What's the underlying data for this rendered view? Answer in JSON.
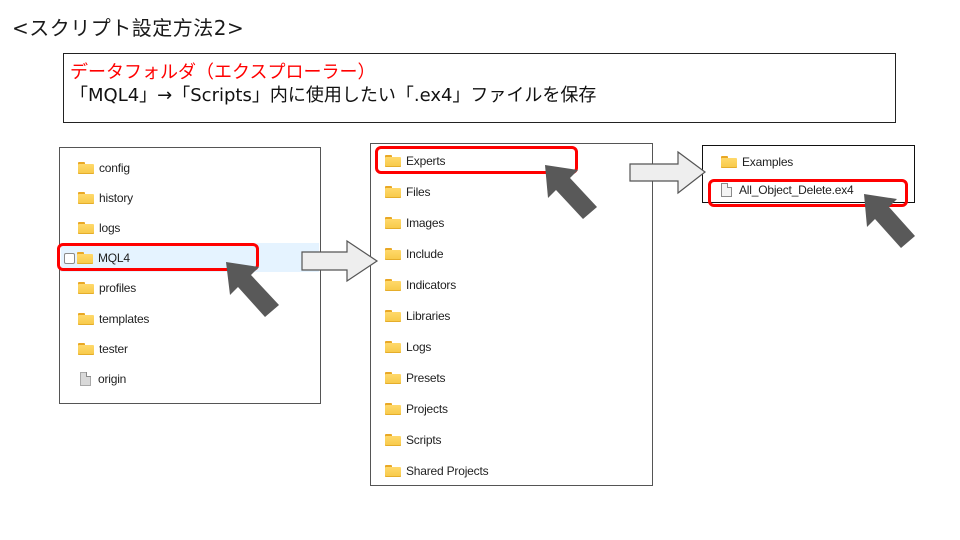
{
  "slide": {
    "title": "<スクリプト設定方法2>"
  },
  "note": {
    "heading": "データフォルダ（エクスプローラー）",
    "instruction": "「MQL4」→「Scripts」内に使用したい「.ex4」ファイルを保存",
    "heading_color": "#ff0000"
  },
  "panels": {
    "root": {
      "items": [
        {
          "label": "config",
          "icon": "folder-icon"
        },
        {
          "label": "history",
          "icon": "folder-icon"
        },
        {
          "label": "logs",
          "icon": "folder-icon"
        },
        {
          "label": "MQL4",
          "icon": "folder-icon",
          "selected": true,
          "highlighted": true
        },
        {
          "label": "profiles",
          "icon": "folder-icon"
        },
        {
          "label": "templates",
          "icon": "folder-icon"
        },
        {
          "label": "tester",
          "icon": "folder-icon"
        },
        {
          "label": "origin",
          "icon": "file-icon"
        }
      ]
    },
    "mql4": {
      "items": [
        {
          "label": "Experts",
          "icon": "folder-icon",
          "highlighted": true
        },
        {
          "label": "Files",
          "icon": "folder-icon"
        },
        {
          "label": "Images",
          "icon": "folder-icon"
        },
        {
          "label": "Include",
          "icon": "folder-icon"
        },
        {
          "label": "Indicators",
          "icon": "folder-icon"
        },
        {
          "label": "Libraries",
          "icon": "folder-icon"
        },
        {
          "label": "Logs",
          "icon": "folder-icon"
        },
        {
          "label": "Presets",
          "icon": "folder-icon"
        },
        {
          "label": "Projects",
          "icon": "folder-icon"
        },
        {
          "label": "Scripts",
          "icon": "folder-icon"
        },
        {
          "label": "Shared Projects",
          "icon": "folder-icon"
        }
      ]
    },
    "experts": {
      "items": [
        {
          "label": "Examples",
          "icon": "folder-icon"
        },
        {
          "label": "All_Object_Delete.ex4",
          "icon": "file-icon",
          "highlighted": true
        }
      ]
    }
  },
  "colors": {
    "highlight": "#ff0000",
    "pointer_arrow": "#595959",
    "flow_arrow_fill": "#eeeeee",
    "selection": "#e5f3ff"
  }
}
